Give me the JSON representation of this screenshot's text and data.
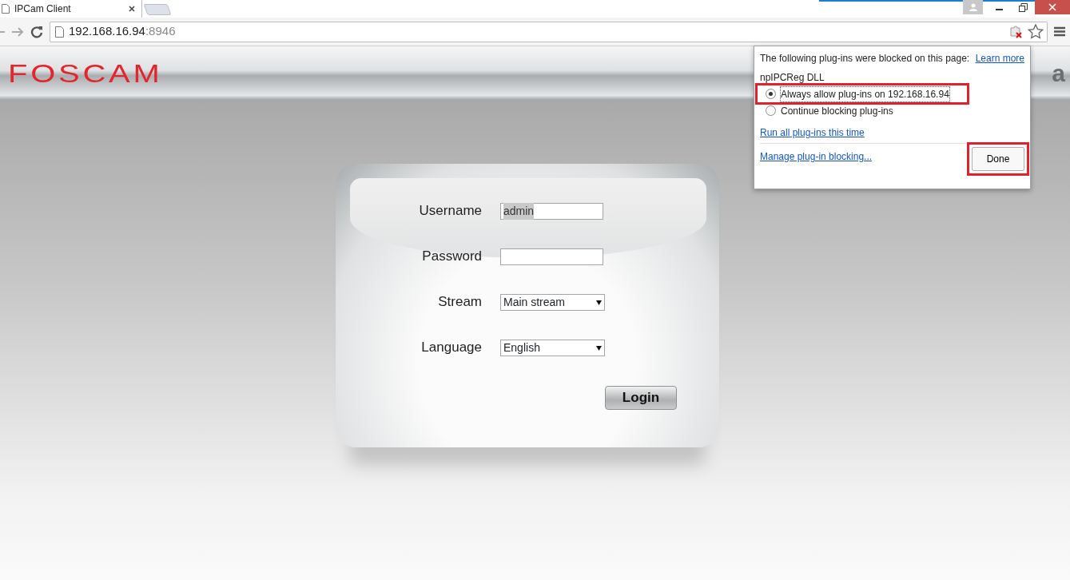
{
  "browser": {
    "tab": {
      "title": "IPCam Client"
    },
    "address": {
      "host": "192.168.16.94",
      "port": ":8946"
    },
    "back_disabled": true,
    "forward_disabled": true
  },
  "header": {
    "logo": "FOSCAM",
    "cut_text": "a"
  },
  "login": {
    "fields": [
      {
        "kind": "text",
        "label": "Username",
        "value": "admin"
      },
      {
        "kind": "password",
        "label": "Password"
      },
      {
        "kind": "select",
        "label": "Stream",
        "value": "Main stream"
      },
      {
        "kind": "select",
        "label": "Language",
        "value": "English"
      }
    ],
    "button": "Login"
  },
  "plugin_popup": {
    "message": "The following plug-ins were blocked on this page:",
    "learn_more": "Learn more",
    "plugin": "npIPCReg DLL",
    "options": [
      {
        "label": "Always allow plug-ins on 192.168.16.94",
        "selected": true,
        "highlighted": true
      },
      {
        "label": "Continue blocking plug-ins",
        "selected": false,
        "highlighted": false
      }
    ],
    "run_all": "Run all plug-ins this time",
    "manage": "Manage plug-in blocking...",
    "done": {
      "label": "Done",
      "highlighted": true
    }
  }
}
